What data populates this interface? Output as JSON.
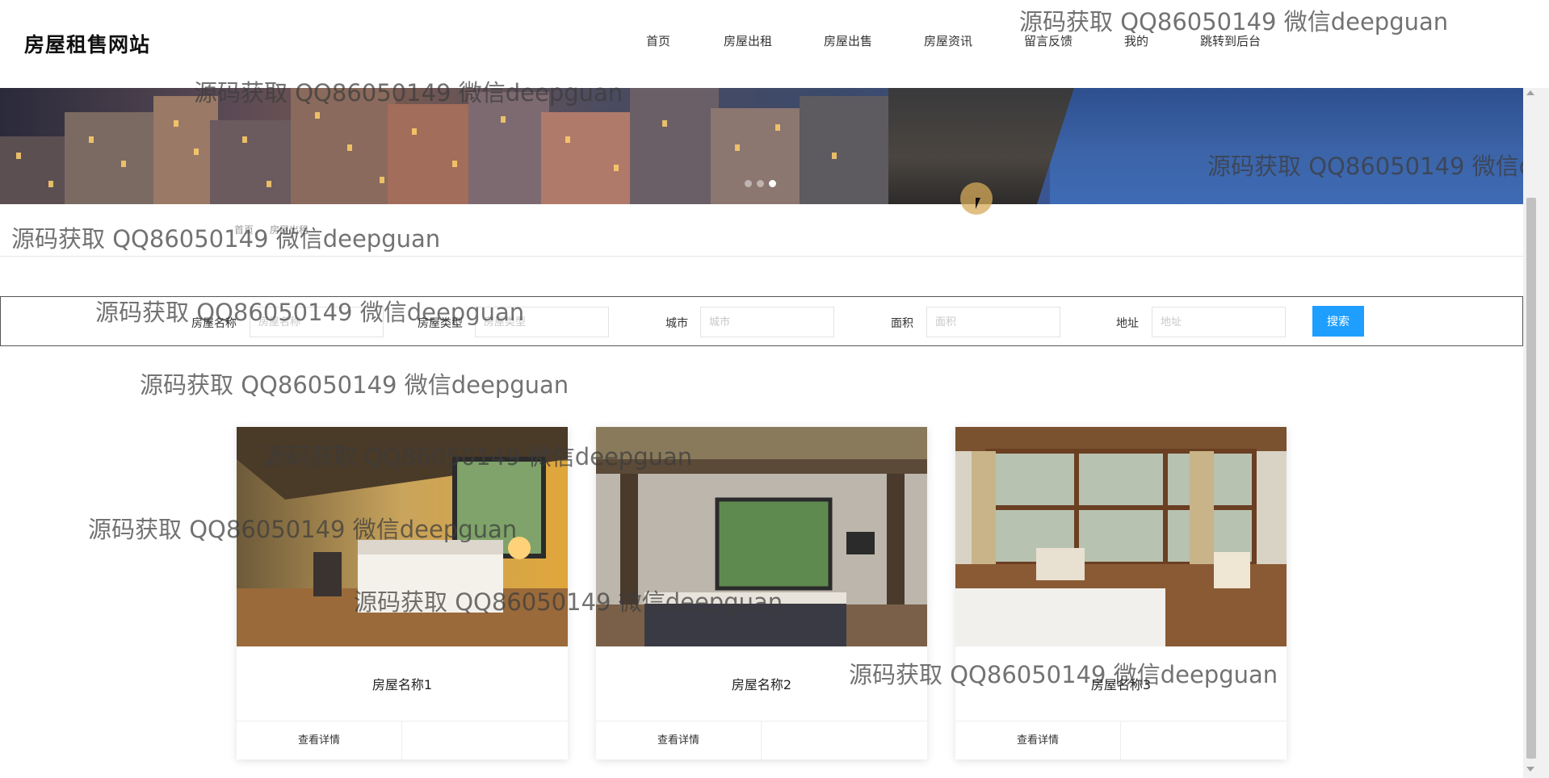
{
  "site": {
    "title": "房屋租售网站"
  },
  "nav": [
    {
      "label": "首页"
    },
    {
      "label": "房屋出租"
    },
    {
      "label": "房屋出售"
    },
    {
      "label": "房屋资讯"
    },
    {
      "label": "留言反馈"
    },
    {
      "label": "我的"
    },
    {
      "label": "跳转到后台"
    }
  ],
  "banner": {
    "slide_count": 3,
    "active_slide": 3
  },
  "breadcrumb": [
    "首页",
    "房屋出租"
  ],
  "search": {
    "fields": [
      {
        "label": "房屋名称",
        "placeholder": "房屋名称",
        "value": ""
      },
      {
        "label": "房屋类型",
        "placeholder": "房屋类型",
        "value": ""
      },
      {
        "label": "城市",
        "placeholder": "城市",
        "value": ""
      },
      {
        "label": "面积",
        "placeholder": "面积",
        "value": ""
      },
      {
        "label": "地址",
        "placeholder": "地址",
        "value": ""
      }
    ],
    "button_label": "搜索"
  },
  "cards": [
    {
      "title": "房屋名称1",
      "detail_label": "查看详情"
    },
    {
      "title": "房屋名称2",
      "detail_label": "查看详情"
    },
    {
      "title": "房屋名称3",
      "detail_label": "查看详情"
    }
  ],
  "watermark": {
    "text": "源码获取 QQ86050149 微信deepguan",
    "text_cut": "源码获取 QQ86050149 微信de"
  },
  "colors": {
    "accent": "#1e9fff",
    "search_border": "#555555"
  }
}
